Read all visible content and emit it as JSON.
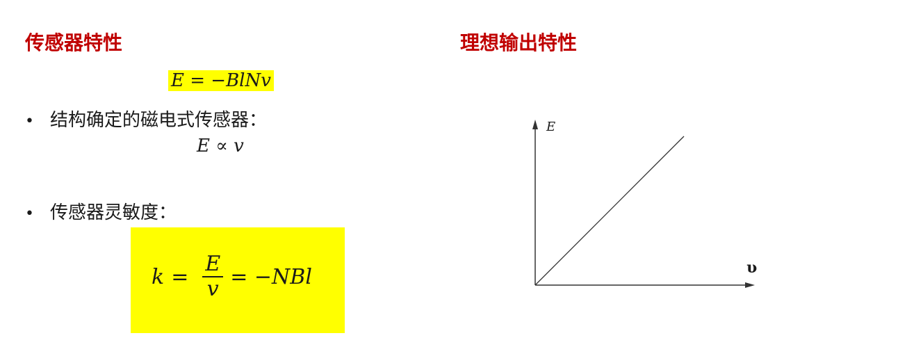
{
  "left": {
    "heading": "传感器特性",
    "formula_top": "E = −BlNv",
    "bullets": [
      {
        "text": "结构确定的磁电式传感器："
      },
      {
        "text": "传感器灵敏度："
      }
    ],
    "proportional": "E ∝ v",
    "sensitivity": {
      "lhs": "k",
      "eq": "=",
      "numerator": "E",
      "denominator": "v",
      "rhs": "= −NBl"
    },
    "highlight_color": "#ffff00"
  },
  "right": {
    "heading": "理想输出特性",
    "graph": {
      "y_axis_label": "E",
      "x_axis_label": "υ",
      "relation": "linear through origin"
    }
  },
  "colors": {
    "heading": "#c00000",
    "text": "#1a1a1a"
  }
}
